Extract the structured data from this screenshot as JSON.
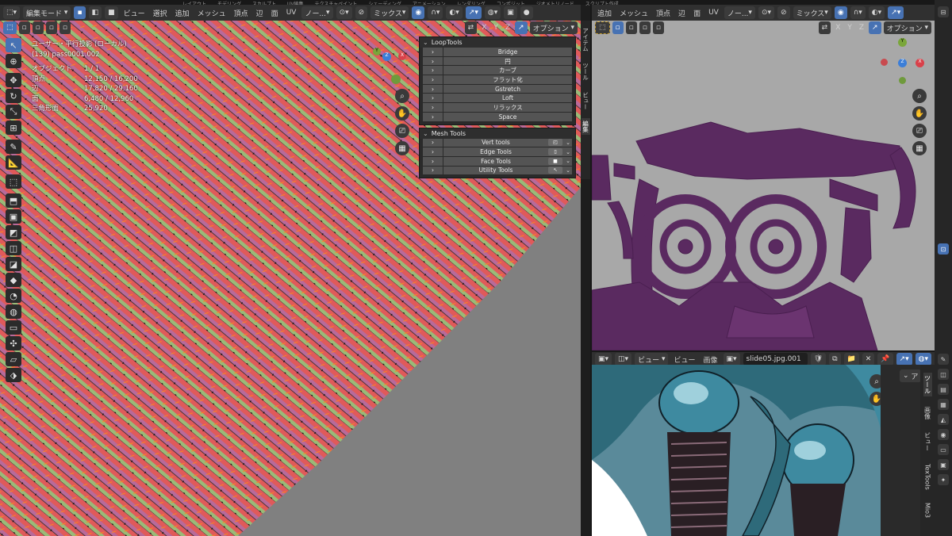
{
  "top_tabs": [
    "レイアウト",
    "モデリング",
    "スカルプト",
    "UV編集",
    "テクスチャペイント",
    "シェーディング",
    "アニメーション",
    "レンダリング",
    "コンポジット",
    "ジオメトリノード",
    "スクリプト作成"
  ],
  "viewport": {
    "mode": "編集モード",
    "menus": [
      "ビュー",
      "選択",
      "追加",
      "メッシュ",
      "頂点",
      "辺",
      "面",
      "UV"
    ],
    "transform": "ノー...",
    "snapping": "ミックス",
    "axes": [
      "X",
      "Y",
      "Z"
    ],
    "options": "オプション",
    "info": {
      "title": "ユーザー・平行投影 (ローカル)",
      "object": "(139) pass0001.002",
      "rows": [
        {
          "k": "オブジェクト",
          "v": "1 / 1"
        },
        {
          "k": "頂点",
          "v": "12,150 / 16,200"
        },
        {
          "k": "辺",
          "v": "17,820 / 29,160"
        },
        {
          "k": "面",
          "v": "6,480 / 12,960"
        },
        {
          "k": "三角形面",
          "v": "25,920"
        }
      ]
    },
    "vtabs": [
      "アイテム",
      "ツール",
      "ビュー",
      "編集"
    ]
  },
  "looptools": {
    "title": "LoopTools",
    "items": [
      "Bridge",
      "円",
      "カーブ",
      "フラット化",
      "Gstretch",
      "Loft",
      "リラックス",
      "Space"
    ]
  },
  "meshtools": {
    "title": "Mesh Tools",
    "items": [
      "Vert tools",
      "Edge Tools",
      "Face Tools",
      "Utility Tools"
    ]
  },
  "uv_editor": {
    "menus": [
      "ビュー",
      "選択",
      "画像"
    ],
    "axes": [
      "X",
      "Y",
      "Z"
    ],
    "options": "オプション",
    "gizmo": [
      "X",
      "Y",
      "Z"
    ],
    "color_uv": "#5a2a60"
  },
  "image_editor": {
    "view_menu": "ビュー",
    "menus": [
      "ビュー",
      "画像"
    ],
    "image_name": "slide05.jpg.001",
    "vtabs": [
      "ツール",
      "画像",
      "ビュー",
      "TexTools",
      "Mio3"
    ],
    "side_label": "ア"
  },
  "colors": {
    "accent": "#4772b3",
    "stripe_a": "#e05a5a",
    "stripe_b": "#9aba78",
    "edge": "#ff8c1a"
  }
}
